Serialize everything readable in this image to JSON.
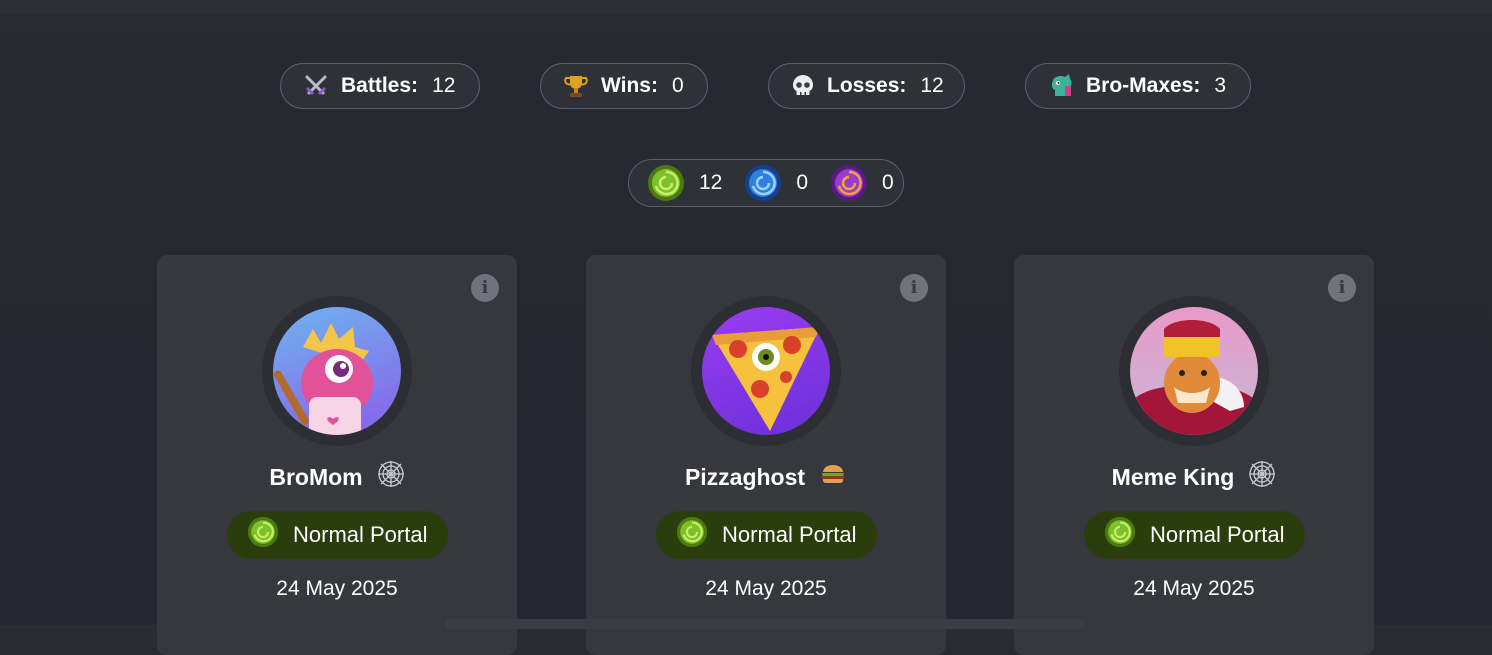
{
  "stats": {
    "battles": {
      "label": "Battles:",
      "value": "12",
      "icon": "crossed-swords-icon"
    },
    "wins": {
      "label": "Wins:",
      "value": "0",
      "icon": "trophy-icon"
    },
    "losses": {
      "label": "Losses:",
      "value": "12",
      "icon": "skull-icon"
    },
    "bromaxes": {
      "label": "Bro-Maxes:",
      "value": "3",
      "icon": "dragon-icon"
    }
  },
  "portals": {
    "green": {
      "value": "12",
      "color": "#7ec02a"
    },
    "blue": {
      "value": "0",
      "color": "#2f7fe0"
    },
    "purple": {
      "value": "0",
      "color": "#9b3cc8"
    }
  },
  "cards": [
    {
      "name": "BroMom",
      "tag_icon": "spiderweb-icon",
      "portal": "Normal Portal",
      "date": "24 May 2025"
    },
    {
      "name": "Pizzaghost",
      "tag_icon": "burger-icon",
      "portal": "Normal Portal",
      "date": "24 May 2025"
    },
    {
      "name": "Meme King",
      "tag_icon": "spiderweb-icon",
      "portal": "Normal Portal",
      "date": "24 May 2025"
    }
  ]
}
